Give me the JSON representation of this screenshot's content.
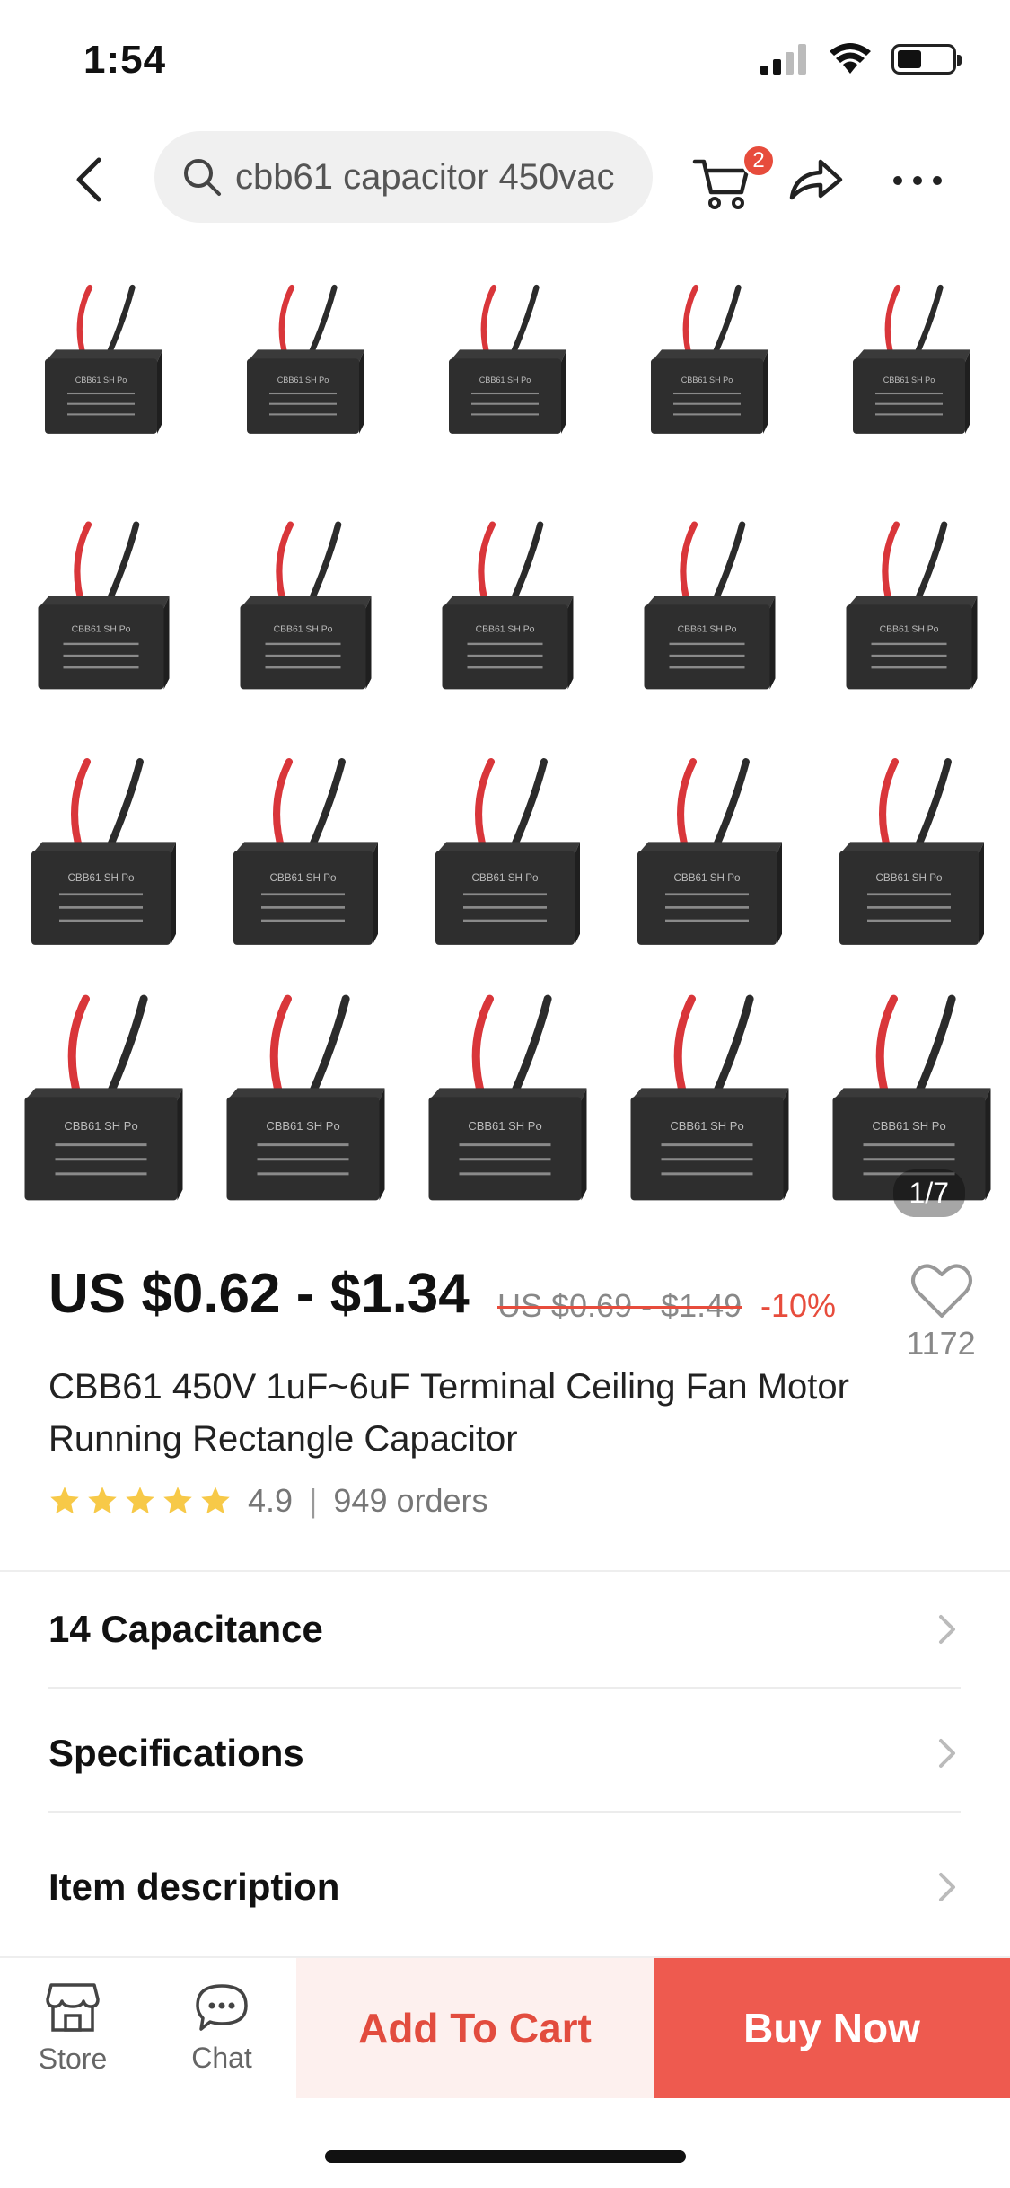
{
  "status_bar": {
    "time": "1:54"
  },
  "search": {
    "query": "cbb61 capacitor 450vac"
  },
  "cart": {
    "badge_count": "2"
  },
  "gallery": {
    "counter": "1/7",
    "capacitor_label": "CBB61 SH Po"
  },
  "price": {
    "current": "US $0.62 - $1.34",
    "original": "US $0.69 - $1.49",
    "discount": "-10%"
  },
  "wishlist": {
    "count": "1172"
  },
  "product": {
    "title": "CBB61 450V 1uF~6uF Terminal Ceiling Fan Motor Running Rectangle Capacitor",
    "rating": "4.9",
    "rating_stars": 5,
    "orders": "949 orders"
  },
  "menu": [
    {
      "label": "14 Capacitance"
    },
    {
      "label": "Specifications"
    },
    {
      "label": "Item description"
    }
  ],
  "bottom_bar": {
    "store_label": "Store",
    "chat_label": "Chat",
    "add_to_cart": "Add To Cart",
    "buy_now": "Buy Now"
  },
  "colors": {
    "accent": "#e74c3c",
    "buy_now_bg": "#ee5a4f",
    "add_cart_bg": "#fdf0ee",
    "star": "#f7c948"
  }
}
